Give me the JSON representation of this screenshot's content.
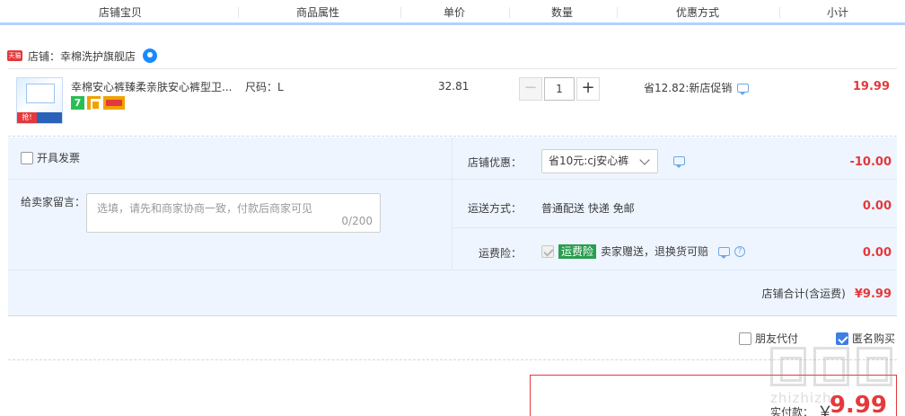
{
  "columns": [
    "店铺宝贝",
    "商品属性",
    "单价",
    "数量",
    "优惠方式",
    "小计"
  ],
  "shop": {
    "badge": "天猫",
    "label": "店铺：幸棉洗护旗舰店"
  },
  "item": {
    "title": "幸棉安心裤臻柔亲肤安心裤型卫...",
    "sku": "尺码：L",
    "badge_seven": "7",
    "price": "32.81",
    "qty": {
      "minus": "−",
      "value": "1",
      "plus": "+"
    },
    "promo": "省12.82:新店促销",
    "subtotal": "19.99",
    "thumb_tag": "抢!"
  },
  "invoice": {
    "label": "开具发票"
  },
  "message": {
    "label": "给卖家留言：",
    "placeholder": "选填，请先和商家协商一致，付款后商家可见",
    "count": "0/200"
  },
  "shop_discount": {
    "label": "店铺优惠：",
    "selected": "省10元:cj安心裤",
    "amount": "-10.00"
  },
  "shipping": {
    "label": "运送方式：",
    "value": "普通配送 快递 免邮",
    "amount": "0.00"
  },
  "insurance": {
    "label": "运费险：",
    "badge": "运费险",
    "text": "卖家赠送，退换货可赔",
    "help": "?",
    "amount": "0.00"
  },
  "shop_total": {
    "label": "店铺合计(含运费)",
    "value": "¥9.99"
  },
  "options": {
    "friend_pay": "朋友代付",
    "anonymous": "匿名购买"
  },
  "payment": {
    "label": "实付款：",
    "currency": "￥",
    "value": "9.99"
  },
  "watermark": {
    "text": "zhizhizhi"
  },
  "colors": {
    "accent": "#e4393c",
    "header_border": "#b2d1ff",
    "panel_bg": "#eef5ff",
    "checkbox": "#3d7ee5",
    "insurance": "#2a9d4f"
  }
}
